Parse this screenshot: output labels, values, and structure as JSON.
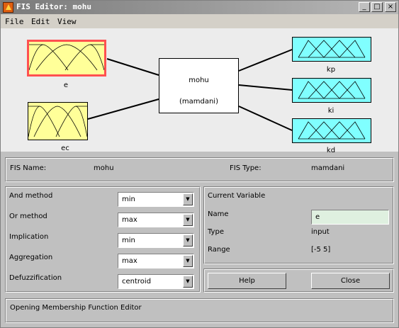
{
  "window": {
    "title": "FIS Editor: mohu"
  },
  "title_buttons": {
    "minimize": "_",
    "maximize": "□",
    "close": "×"
  },
  "menu": [
    "File",
    "Edit",
    "View"
  ],
  "diagram": {
    "inputs": [
      "e",
      "ec"
    ],
    "outputs": [
      "kp",
      "ki",
      "kd"
    ],
    "system_name": "mohu",
    "system_type": "(mamdani)",
    "colors": {
      "input_fill": "#ffff99",
      "output_fill": "#80ffff",
      "selected_border": "#ff5050"
    }
  },
  "fis_info": {
    "name_label": "FIS Name:",
    "name_value": "mohu",
    "type_label": "FIS Type:",
    "type_value": "mamdani"
  },
  "methods": [
    {
      "label": "And method",
      "value": "min"
    },
    {
      "label": "Or method",
      "value": "max"
    },
    {
      "label": "Implication",
      "value": "min"
    },
    {
      "label": "Aggregation",
      "value": "max"
    },
    {
      "label": "Defuzzification",
      "value": "centroid"
    }
  ],
  "current_variable": {
    "heading": "Current Variable",
    "name_label": "Name",
    "name_value": "e",
    "type_label": "Type",
    "type_value": "input",
    "range_label": "Range",
    "range_value": "[-5 5]"
  },
  "buttons": {
    "help": "Help",
    "close": "Close"
  },
  "status": {
    "message": "Opening Membership Function Editor"
  }
}
